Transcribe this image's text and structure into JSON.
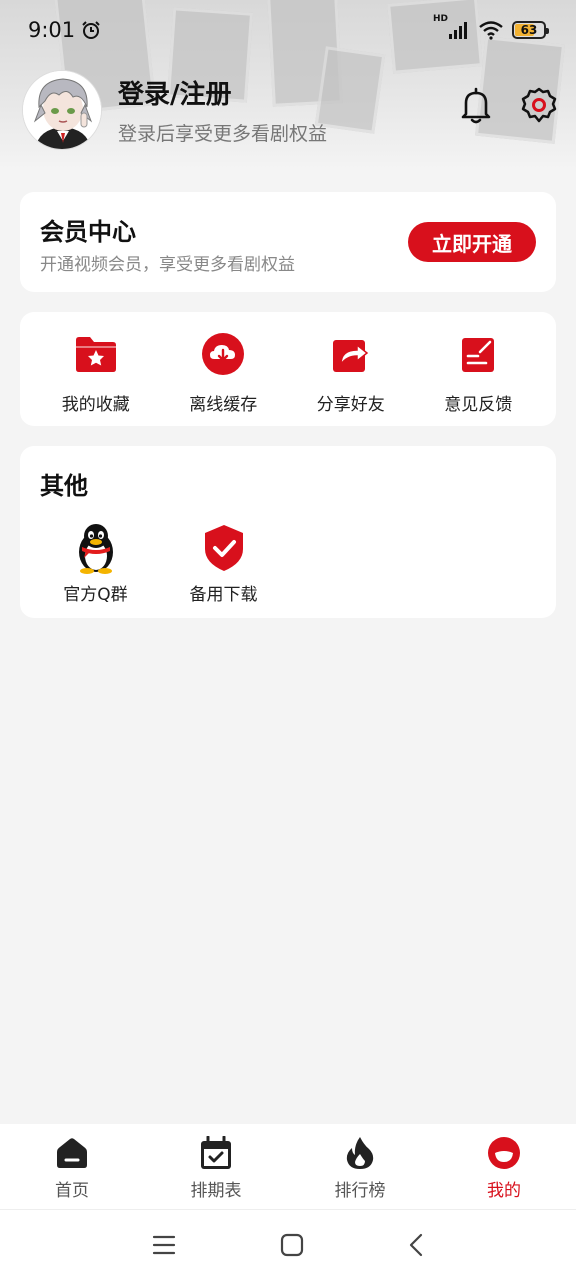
{
  "status_bar": {
    "time": "9:01",
    "battery_level": "63",
    "network": "HD"
  },
  "profile": {
    "title": "登录/注册",
    "subtitle": "登录后享受更多看剧权益"
  },
  "vip": {
    "title": "会员中心",
    "subtitle": "开通视频会员，享受更多看剧权益",
    "button": "立即开通"
  },
  "actions": [
    {
      "label": "我的收藏",
      "icon": "folder-star-icon"
    },
    {
      "label": "离线缓存",
      "icon": "cloud-download-icon"
    },
    {
      "label": "分享好友",
      "icon": "share-icon"
    },
    {
      "label": "意见反馈",
      "icon": "feedback-icon"
    }
  ],
  "other": {
    "title": "其他",
    "items": [
      {
        "label": "官方Q群",
        "icon": "qq-penguin-icon"
      },
      {
        "label": "备用下载",
        "icon": "shield-check-icon"
      }
    ]
  },
  "bottom_nav": {
    "items": [
      {
        "label": "首页",
        "icon": "home-icon"
      },
      {
        "label": "排期表",
        "icon": "calendar-check-icon"
      },
      {
        "label": "排行榜",
        "icon": "flame-icon"
      },
      {
        "label": "我的",
        "icon": "profile-face-icon",
        "active": true
      }
    ]
  },
  "colors": {
    "accent": "#d8101c",
    "background": "#f4f4f4",
    "battery": "#f2b233"
  }
}
